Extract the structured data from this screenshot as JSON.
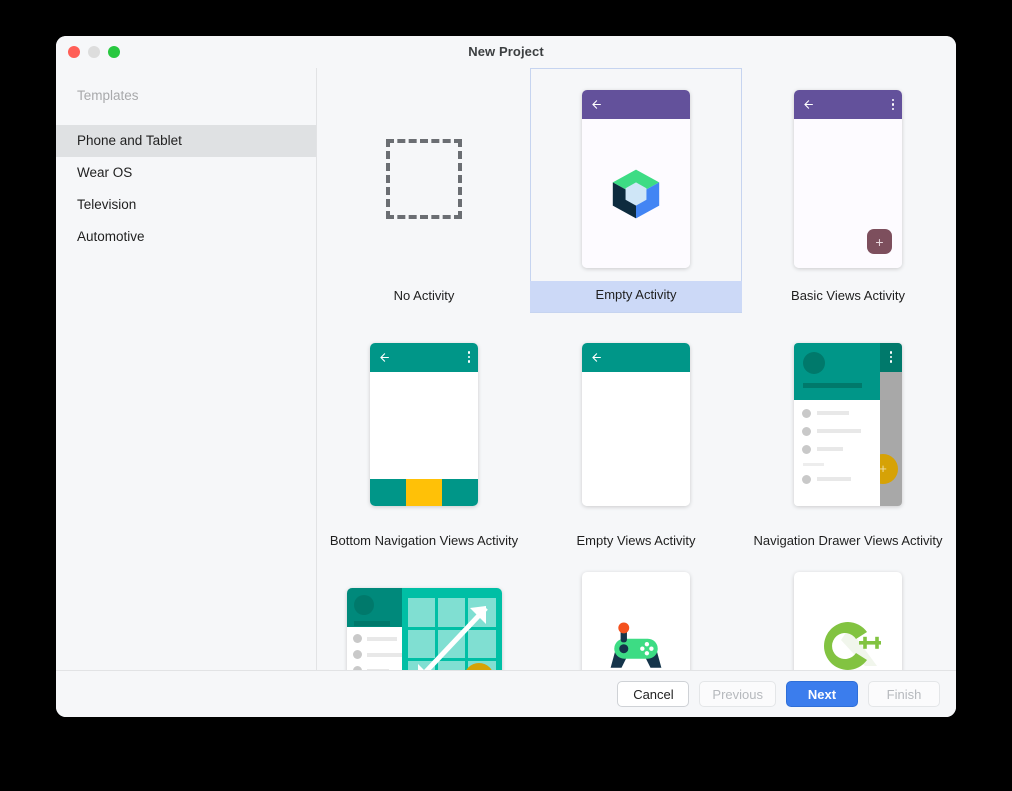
{
  "window": {
    "title": "New Project",
    "controls": {
      "close": "close-button",
      "minimize": "minimize-button",
      "zoom": "zoom-button"
    }
  },
  "sidebar": {
    "header": "Templates",
    "items": [
      {
        "label": "Phone and Tablet",
        "selected": true
      },
      {
        "label": "Wear OS",
        "selected": false
      },
      {
        "label": "Television",
        "selected": false
      },
      {
        "label": "Automotive",
        "selected": false
      }
    ]
  },
  "templates": [
    {
      "label": "No Activity",
      "selected": false
    },
    {
      "label": "Empty Activity",
      "selected": true
    },
    {
      "label": "Basic Views Activity",
      "selected": false
    },
    {
      "label": "Bottom Navigation Views Activity",
      "selected": false
    },
    {
      "label": "Empty Views Activity",
      "selected": false
    },
    {
      "label": "Navigation Drawer Views Activity",
      "selected": false
    },
    {
      "label": "",
      "selected": false
    },
    {
      "label": "",
      "selected": false
    },
    {
      "label": "",
      "selected": false
    }
  ],
  "footer": {
    "cancel": "Cancel",
    "previous": "Previous",
    "next": "Next",
    "finish": "Finish"
  },
  "colors": {
    "selection_fill": "#ccd9f7",
    "selection_border": "#c6d4f0",
    "primary_button": "#3b7ded",
    "toolbar_purple": "#63519b",
    "toolbar_teal": "#009688",
    "accent_yellow": "#ffc107",
    "fab_mauve": "#7d4f5d",
    "window_bg": "#f6f7f9"
  },
  "fab_label": "+"
}
